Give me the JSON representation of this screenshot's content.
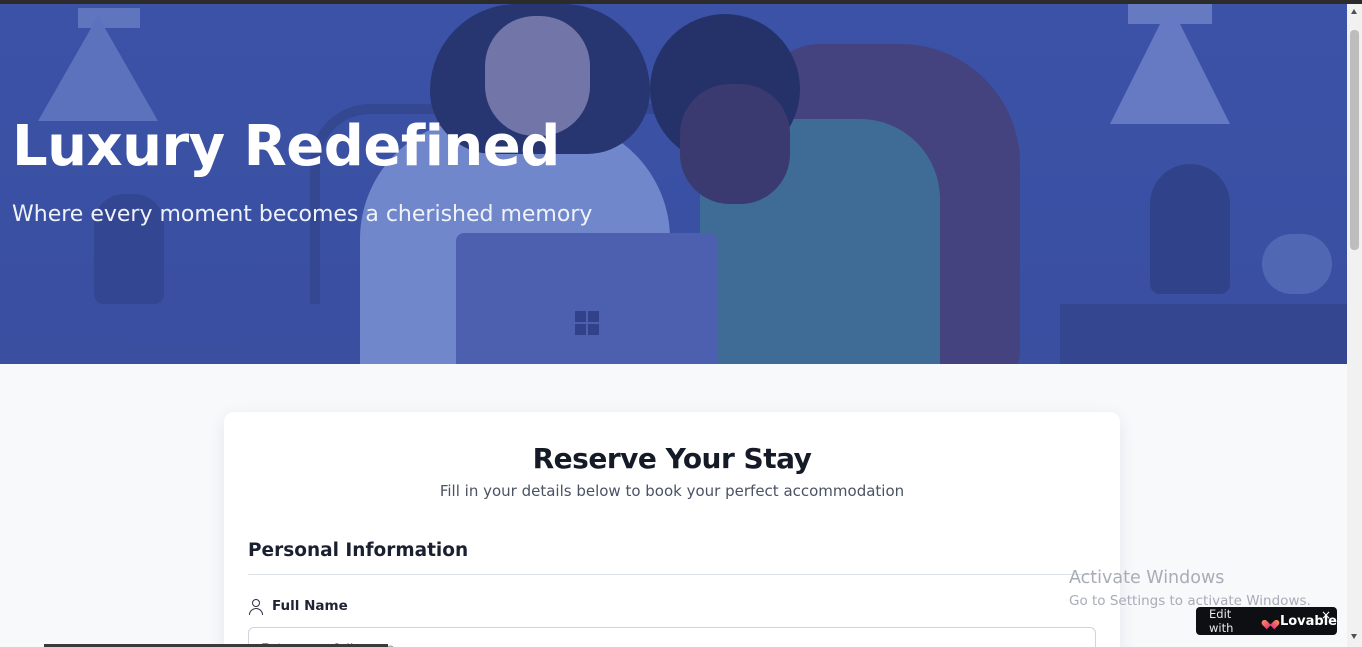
{
  "hero": {
    "title": "Luxury Redefined",
    "subtitle": "Where every moment becomes a cherished memory"
  },
  "form": {
    "title": "Reserve Your Stay",
    "subtitle": "Fill in your details below to book your perfect accommodation",
    "section_personal": "Personal Information",
    "full_name_label": "Full Name",
    "full_name_placeholder": "Enter your full name",
    "full_name_value": ""
  },
  "windows_watermark": {
    "title": "Activate Windows",
    "subtitle": "Go to Settings to activate Windows."
  },
  "lovable_badge": {
    "edit_with": "Edit with",
    "brand": "Lovable",
    "close": "×"
  },
  "colors": {
    "hero_overlay": "#3b52a6",
    "page_bg": "#f8f9fb",
    "badge_bg": "#0e0f12"
  },
  "icons": {
    "field_icon": "user-icon",
    "laptop_logo": "windows-logo-icon",
    "badge_icon": "lovable-heart-icon"
  }
}
